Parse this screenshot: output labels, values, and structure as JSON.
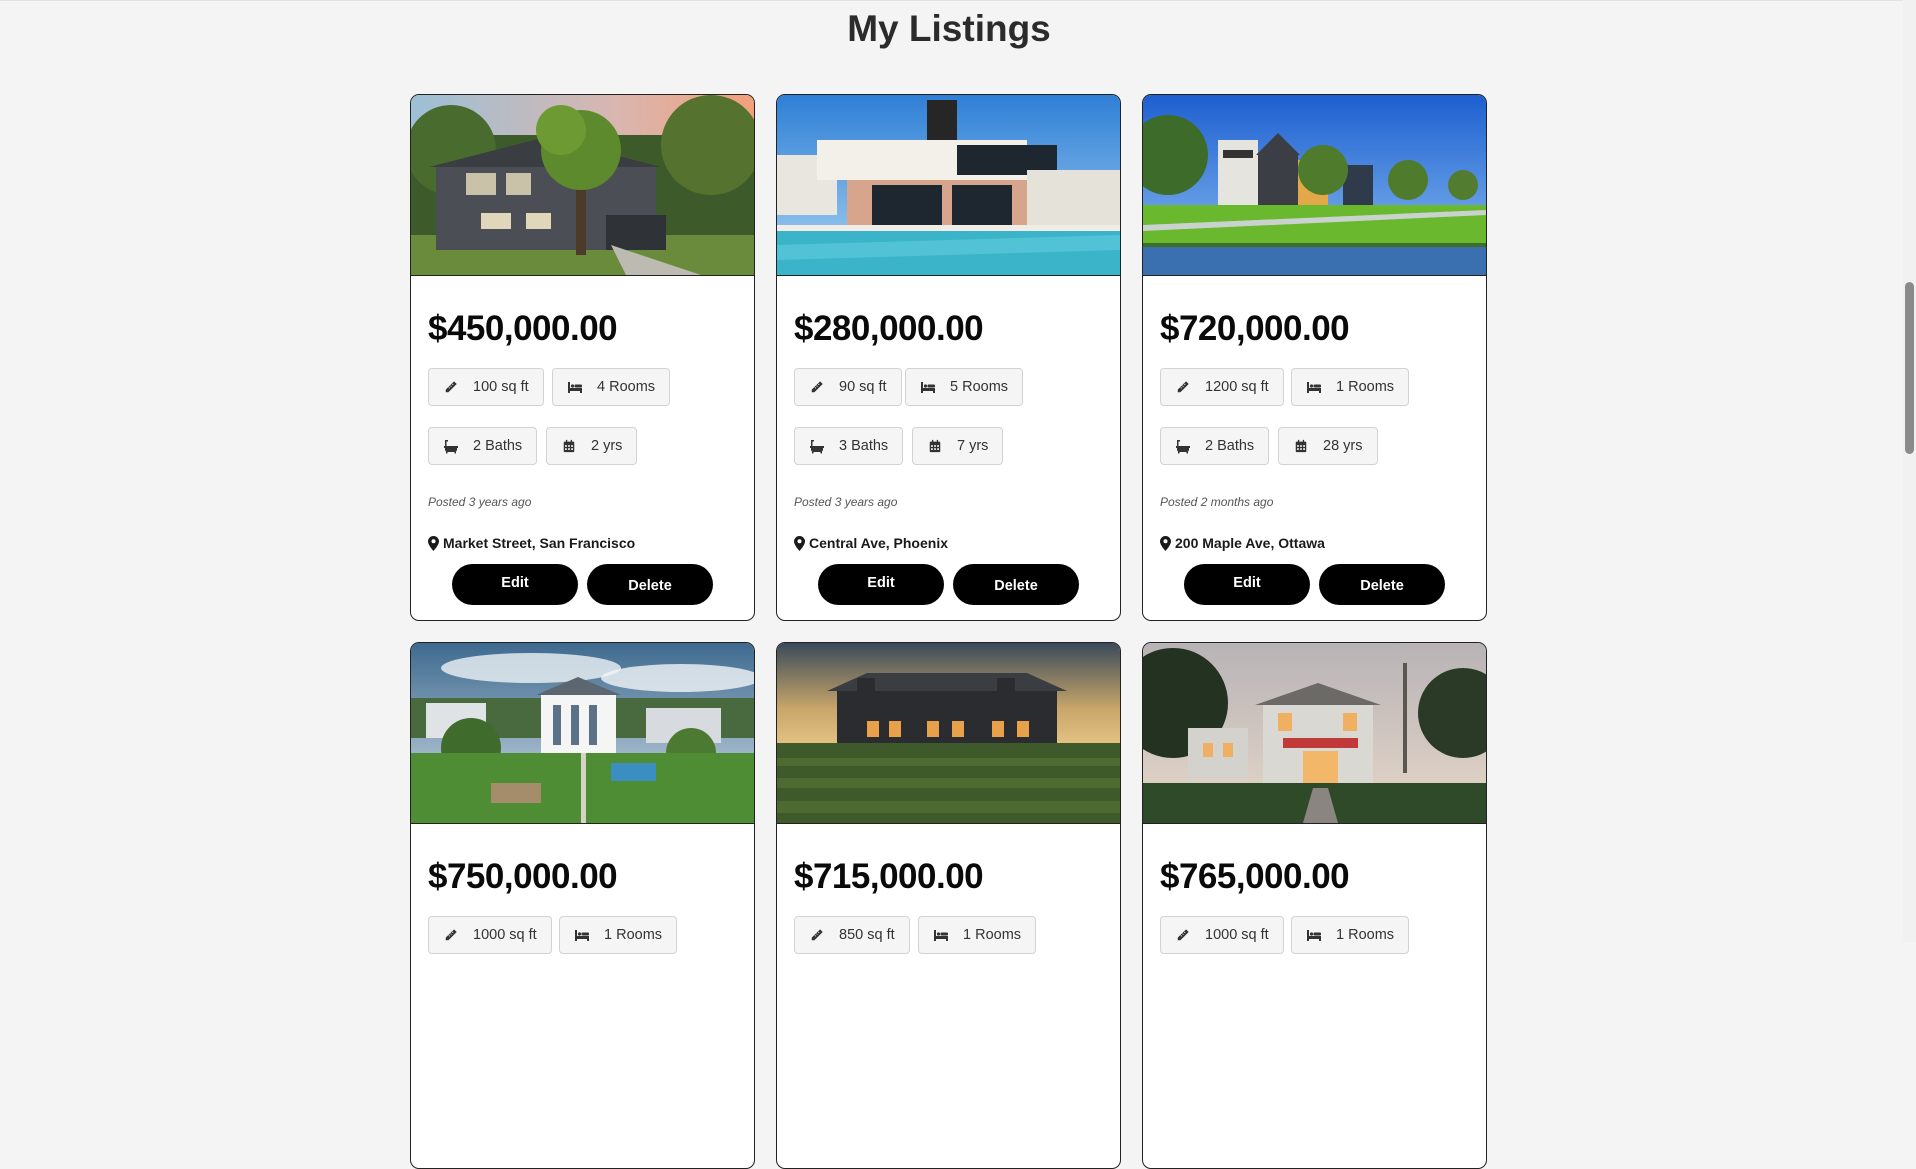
{
  "page": {
    "title": "My Listings"
  },
  "listings": [
    {
      "price": "$450,000.00",
      "area": "100 sq ft",
      "rooms": "4 Rooms",
      "baths": "2 Baths",
      "age": "2 yrs",
      "posted": "Posted 3 years ago",
      "location": "Market Street, San Francisco",
      "edit_label": "Edit",
      "delete_label": "Delete",
      "image": "dark-grey-house-with-tree"
    },
    {
      "price": "$280,000.00",
      "area": "90 sq ft",
      "rooms": "5 Rooms",
      "baths": "3 Baths",
      "age": "7 yrs",
      "posted": "Posted 3 years ago",
      "location": "Central Ave, Phoenix",
      "edit_label": "Edit",
      "delete_label": "Delete",
      "image": "modern-villa-with-pool"
    },
    {
      "price": "$720,000.00",
      "area": "1200 sq ft",
      "rooms": "1 Rooms",
      "baths": "2 Baths",
      "age": "28 yrs",
      "posted": "Posted 2 months ago",
      "location": "200 Maple Ave, Ottawa",
      "edit_label": "Edit",
      "delete_label": "Delete",
      "image": "modern-houses-by-canal"
    },
    {
      "price": "$750,000.00",
      "area": "1000 sq ft",
      "rooms": "1 Rooms",
      "image": "coastal-white-mansion"
    },
    {
      "price": "$715,000.00",
      "area": "850 sq ft",
      "rooms": "1 Rooms",
      "image": "dark-barn-house-at-dusk"
    },
    {
      "price": "$765,000.00",
      "area": "1000 sq ft",
      "rooms": "1 Rooms",
      "image": "white-cottage-at-night"
    }
  ],
  "icons": {
    "area": "ruler-icon",
    "rooms": "bed-icon",
    "baths": "bath-icon",
    "age": "calendar-icon",
    "location": "map-pin-icon"
  },
  "colors": {
    "background": "#f4f4f4",
    "button": "#000000",
    "chip": "#f5f5f5"
  }
}
